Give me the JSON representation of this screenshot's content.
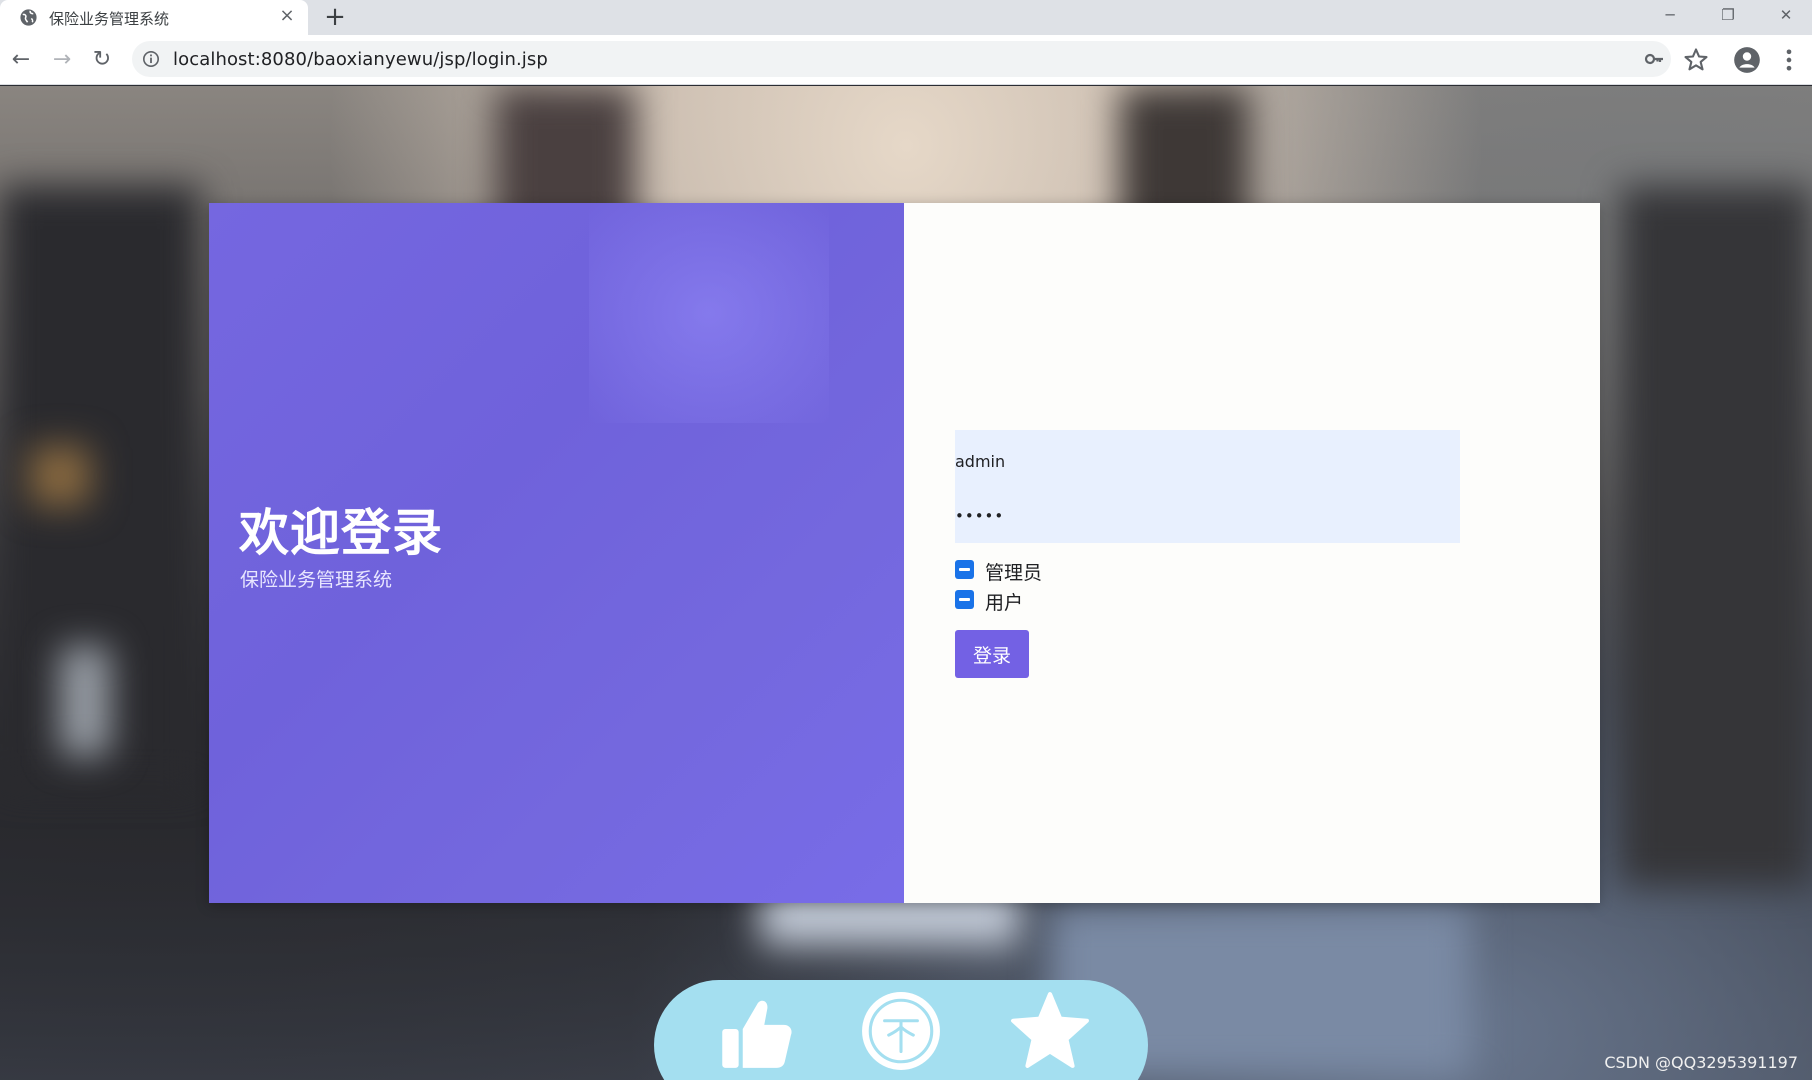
{
  "browser": {
    "tab_title": "保险业务管理系统",
    "tab_close": "×",
    "new_tab": "+",
    "url": "localhost:8080/baoxianyewu/jsp/login.jsp",
    "window_controls": {
      "minimize": "─",
      "restore": "❐",
      "close": "✕"
    },
    "nav": {
      "back": "←",
      "forward": "→",
      "reload": "↻"
    },
    "icons": [
      "globe-icon",
      "info-icon",
      "key-icon",
      "star-icon",
      "profile-icon",
      "menu-icon"
    ]
  },
  "login": {
    "welcome_title": "欢迎登录",
    "system_name": "保险业务管理系统",
    "username_value": "admin",
    "password_value": "•••••",
    "roles": [
      {
        "label": "管理员",
        "checked": true
      },
      {
        "label": "用户",
        "checked": true
      }
    ],
    "submit_label": "登录"
  },
  "floating_bar": {
    "icons": [
      "thumbs-up-icon",
      "coin-icon",
      "star-icon"
    ],
    "color": "#a4dff0"
  },
  "watermark": "CSDN @QQ3295391197",
  "colors": {
    "accent_purple": "#7361e4",
    "panel_purple": "#7567e0",
    "checkbox_blue": "#1a73e8",
    "input_bg": "#e8f0fe"
  }
}
